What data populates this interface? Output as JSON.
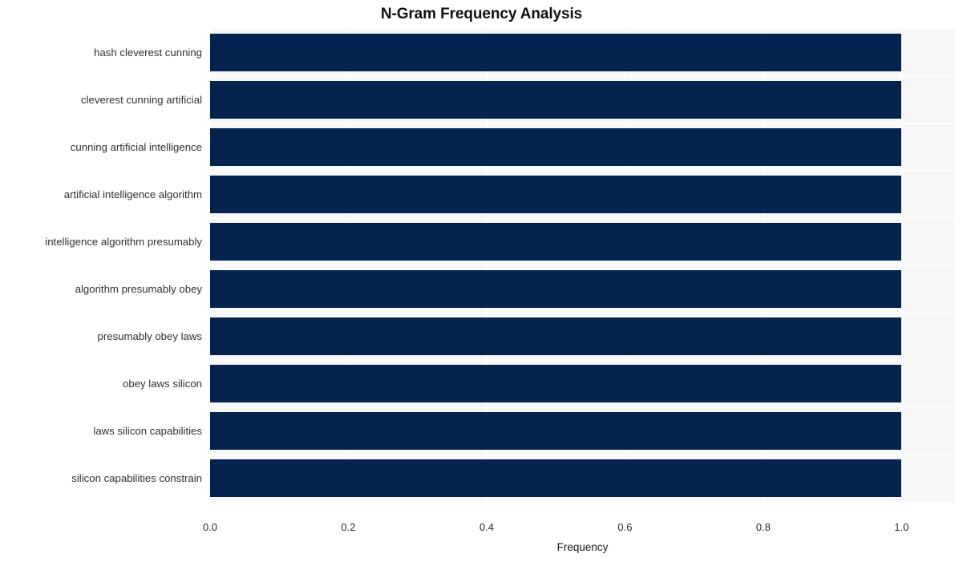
{
  "chart_data": {
    "type": "bar",
    "orientation": "horizontal",
    "title": "N-Gram Frequency Analysis",
    "xlabel": "Frequency",
    "ylabel": "",
    "categories": [
      "hash cleverest cunning",
      "cleverest cunning artificial",
      "cunning artificial intelligence",
      "artificial intelligence algorithm",
      "intelligence algorithm presumably",
      "algorithm presumably obey",
      "presumably obey laws",
      "obey laws silicon",
      "laws silicon capabilities",
      "silicon capabilities constrain"
    ],
    "values": [
      1.0,
      1.0,
      1.0,
      1.0,
      1.0,
      1.0,
      1.0,
      1.0,
      1.0,
      1.0
    ],
    "xticks": [
      "0.0",
      "0.2",
      "0.4",
      "0.6",
      "0.8",
      "1.0"
    ],
    "xtick_values": [
      0.0,
      0.2,
      0.4,
      0.6,
      0.8,
      1.0
    ],
    "xlim": [
      0.0,
      1.0772
    ],
    "grid": true,
    "legend": null,
    "bar_color": "#04234f",
    "plot_background": "#f7f7f7",
    "gridline_color": "#ffffff",
    "figure_background": "#ffffff"
  }
}
